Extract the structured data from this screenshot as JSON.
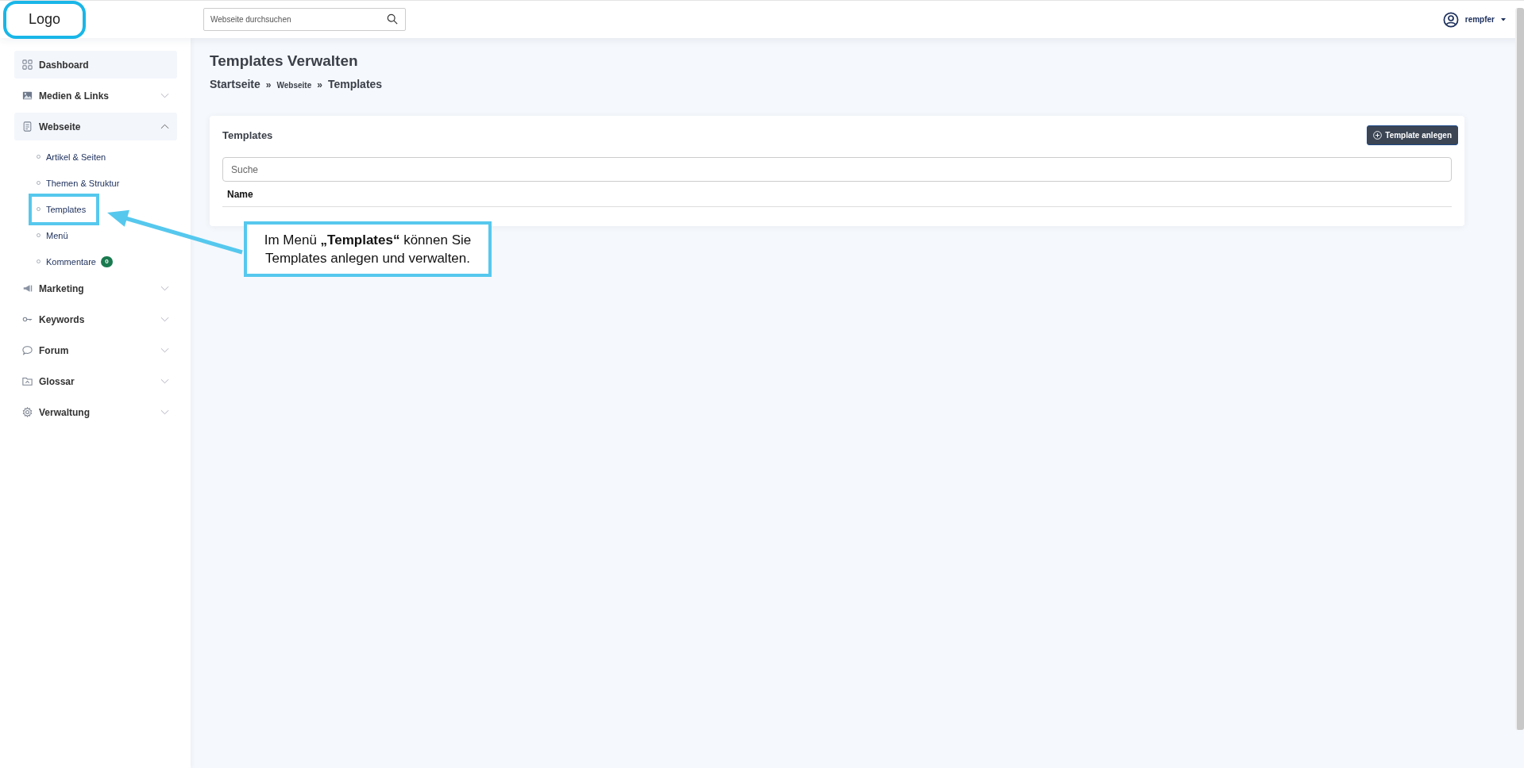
{
  "header": {
    "logo": {
      "text": "Logo",
      "highlighted": true
    },
    "search": {
      "placeholder": "Webseite durchsuchen"
    },
    "user": {
      "name": "rempfer"
    }
  },
  "sidebar": {
    "items": [
      {
        "label": "Dashboard",
        "active": true
      },
      {
        "label": "Medien & Links",
        "active": false,
        "expanded": false
      },
      {
        "label": "Webseite",
        "active": true,
        "expanded": true,
        "children": [
          {
            "label": "Artikel & Seiten",
            "highlighted": false
          },
          {
            "label": "Themen & Struktur",
            "highlighted": false
          },
          {
            "label": "Templates",
            "highlighted": true
          },
          {
            "label": "Menü",
            "highlighted": false
          },
          {
            "label": "Kommentare",
            "highlighted": false,
            "badge": "0"
          }
        ]
      },
      {
        "label": "Marketing",
        "active": false,
        "expanded": false
      },
      {
        "label": "Keywords",
        "active": false,
        "expanded": false
      },
      {
        "label": "Forum",
        "active": false,
        "expanded": false
      },
      {
        "label": "Glossar",
        "active": false,
        "expanded": false
      },
      {
        "label": "Verwaltung",
        "active": false,
        "expanded": false
      }
    ]
  },
  "page": {
    "title": "Templates Verwalten",
    "breadcrumb": [
      {
        "label": "Startseite",
        "kind": "page"
      },
      {
        "label": "»",
        "kind": "separator"
      },
      {
        "label": "Webseite",
        "kind": "section"
      },
      {
        "label": "»",
        "kind": "separator"
      },
      {
        "label": "Templates",
        "kind": "page"
      }
    ]
  },
  "card": {
    "title": "Templates",
    "button": "Template anlegen",
    "search": {
      "placeholder": "Suche"
    },
    "table": {
      "columns": [
        "Name"
      ]
    }
  },
  "callout": {
    "text": "Im Menü **„Templates“** können Sie Templates anlegen und verwalten."
  }
}
